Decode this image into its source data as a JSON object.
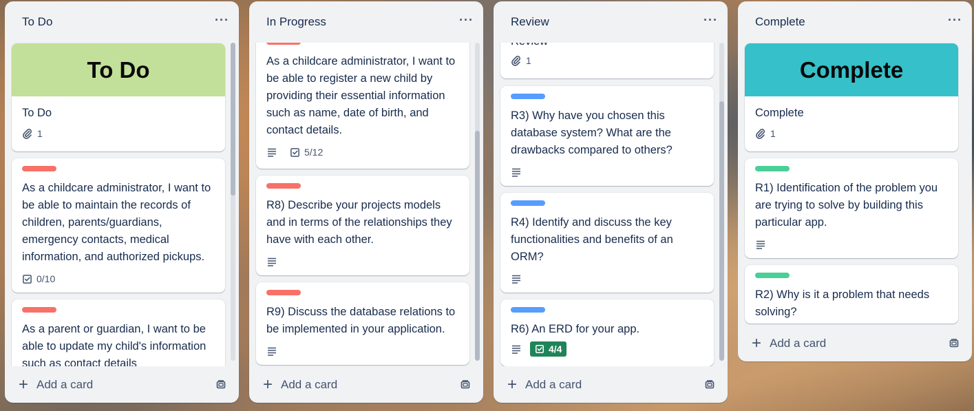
{
  "colors": {
    "label_red": "#f87168",
    "label_blue": "#579dff",
    "label_green": "#4bce97",
    "cover_todo": "#c2e09a",
    "cover_complete": "#36c0c9",
    "checklist_done": "#1f845a"
  },
  "icons": [
    "ellipsis-icon",
    "attachment-icon",
    "checklist-icon",
    "description-icon",
    "plus-icon",
    "template-icon"
  ],
  "add_card_label": "Add a card",
  "lists": [
    {
      "title": "To Do",
      "menu": "···",
      "cards": [
        {
          "cover": "To Do",
          "text": "To Do",
          "attachments": "1"
        },
        {
          "text": "As a childcare administrator, I want to be able to maintain the records of children, parents/guardians, emergency contacts, medical information, and authorized pickups.",
          "checklist": "0/10"
        },
        {
          "text": "As a parent or guardian, I want to be able to update my child's information such as contact details"
        }
      ]
    },
    {
      "title": "In Progress",
      "menu": "···",
      "cards": [
        {
          "text": "As a childcare administrator, I want to be able to register a new child by providing their essential information such as name, date of birth, and contact details.",
          "checklist": "5/12"
        },
        {
          "text": "R8) Describe your projects models and in terms of the relationships they have with each other."
        },
        {
          "text": "R9) Discuss the database relations to be implemented in your application."
        }
      ]
    },
    {
      "title": "Review",
      "menu": "···",
      "cards": [
        {
          "text": "Review",
          "attachments": "1"
        },
        {
          "text": "R3) Why have you chosen this database system? What are the drawbacks compared to others?"
        },
        {
          "text": "R4) Identify and discuss the key functionalities and benefits of an ORM?"
        },
        {
          "text": "R6) An ERD for your app.",
          "checklist": "4/4"
        }
      ]
    },
    {
      "title": "Complete",
      "menu": "···",
      "cards": [
        {
          "cover": "Complete",
          "text": "Complete",
          "attachments": "1"
        },
        {
          "text": "R1) Identification of the problem you are trying to solve by building this particular app."
        },
        {
          "text": "R2) Why is it a problem that needs solving?"
        }
      ]
    }
  ]
}
